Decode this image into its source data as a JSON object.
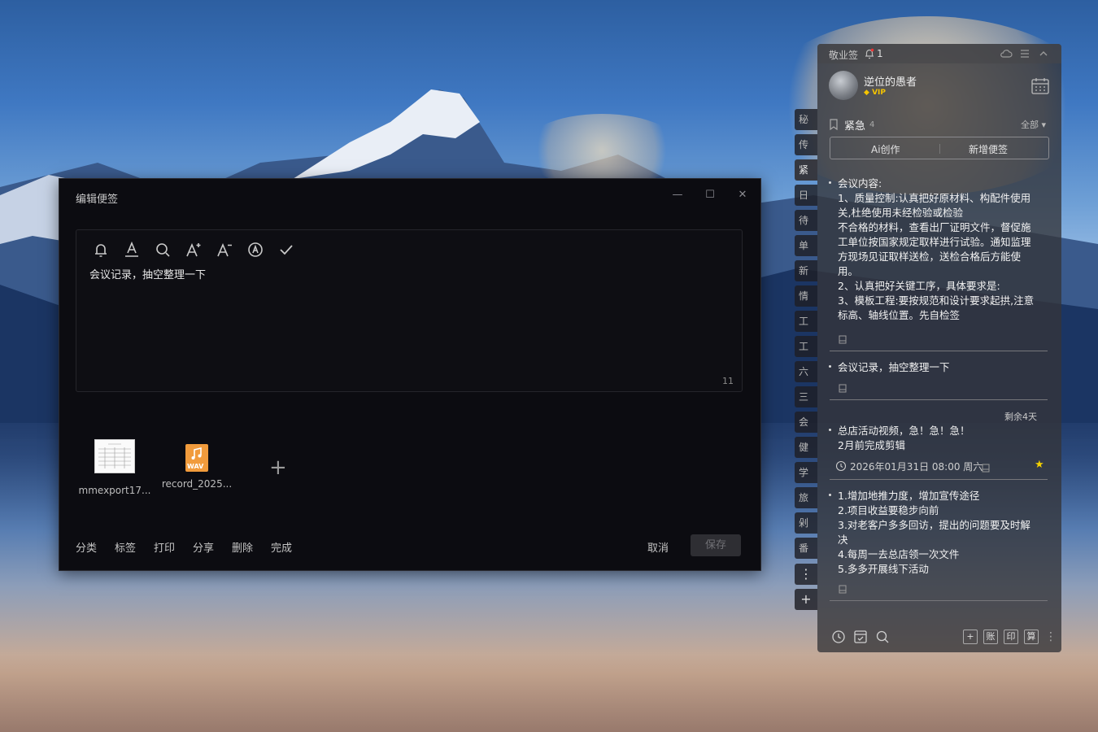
{
  "editor": {
    "title": "编辑便签",
    "window_buttons": {
      "minimize": "—",
      "maximize": "☐",
      "close": "✕"
    },
    "content": "会议记录，抽空整理一下",
    "char_count": "11",
    "attachments": [
      {
        "name": "mmexport17...",
        "type": "image"
      },
      {
        "name": "record_2025...",
        "type": "wav",
        "badge": "WAV"
      }
    ],
    "add_attachment": "+",
    "footer_left": [
      "分类",
      "标签",
      "打印",
      "分享",
      "删除",
      "完成"
    ],
    "cancel": "取消",
    "save": "保存"
  },
  "side_tabs": [
    "秘密",
    "传输",
    "紧急",
    "日程",
    "待办",
    "单词",
    "新年",
    "情感",
    "工作",
    "工作",
    "六班",
    "三班",
    "会员",
    "健康",
    "学习",
    "旅游",
    "剁手",
    "番茄"
  ],
  "active_tab_index": 2,
  "side_controls": {
    "more": "⋮",
    "add": "+"
  },
  "panel": {
    "app_name": "敬业签",
    "notification_count": "1",
    "user": {
      "name": "逆位的愚者",
      "vip": "VIP"
    },
    "category": {
      "label": "紧急",
      "count": "4",
      "filter": "全部 ▾"
    },
    "actions": [
      "Ai创作",
      "新增便签"
    ],
    "notes": [
      {
        "lines": [
          "会议内容:",
          "1、质量控制:认真把好原材料、构配件使用",
          "关,杜绝使用未经检验或检验",
          "不合格的材料，查看出厂证明文件，督促施",
          "工单位按国家规定取样进行试验。通知监理",
          "方现场见证取样送检，送检合格后方能使",
          "用。",
          "2、认真把好关键工序，具体要求是:",
          "3、模板工程:要按规范和设计要求起拱,注意",
          "标高、轴线位置。先自检签"
        ]
      },
      {
        "lines": [
          "会议记录，抽空整理一下"
        ]
      },
      {
        "remaining": "剩余4天",
        "lines": [
          "总店活动视频，急！急！急！",
          "2月前完成剪辑"
        ],
        "datetime": "2026年01月31日 08:00 周六",
        "starred": true
      },
      {
        "lines": [
          "1.增加地推力度，增加宣传途径",
          "2.项目收益要稳步向前",
          "3.对老客户多多回访，提出的问题要及时解",
          "决",
          "4.每周一去总店领一次文件",
          "5.多多开展线下活动"
        ]
      }
    ],
    "bottom_icons": [
      "clock-icon",
      "checklist-icon",
      "search-icon"
    ],
    "bottom_squares": [
      "+",
      "账",
      "印",
      "算"
    ],
    "more": "⋮"
  },
  "colors": {
    "star": "#f5d200",
    "vip": "#f5c400",
    "editor_bg": "#0c0c11"
  }
}
